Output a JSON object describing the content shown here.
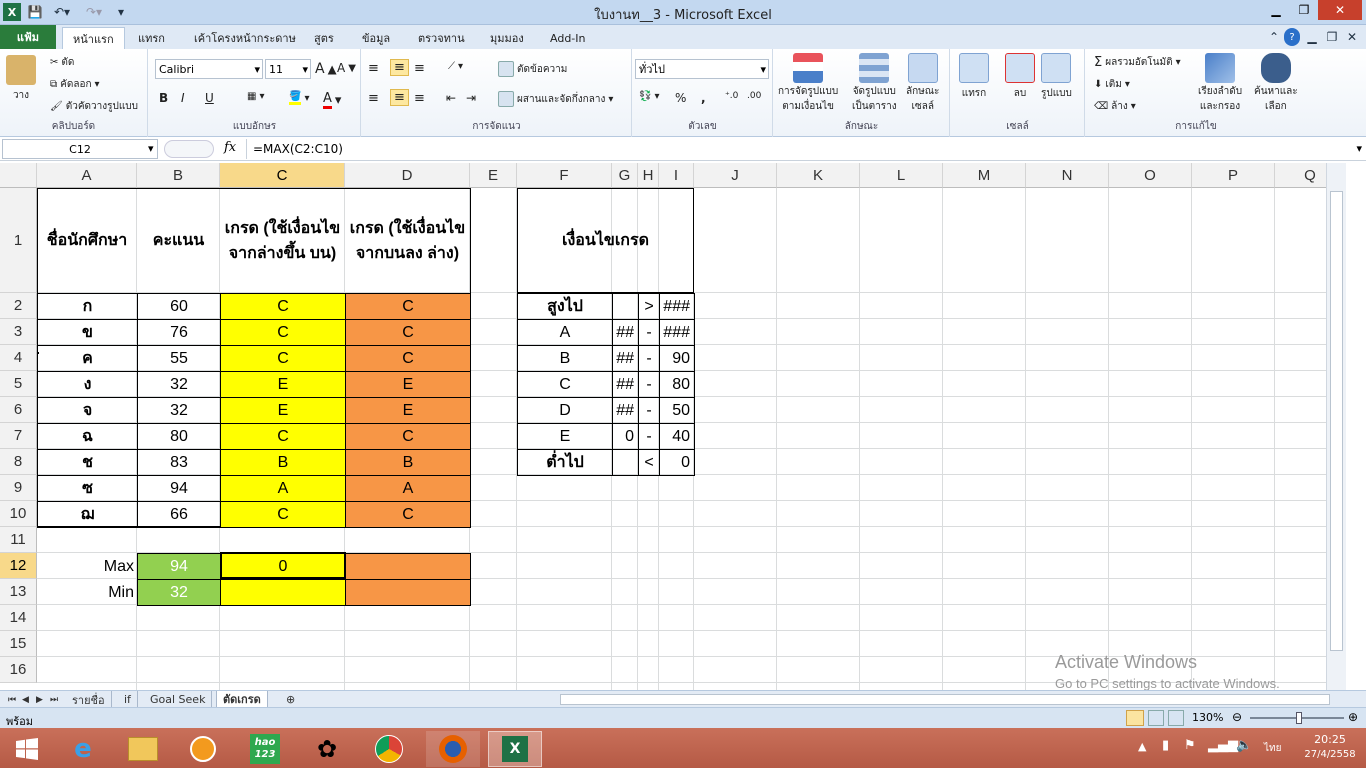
{
  "window": {
    "title": "ใบงานท__3  -  Microsoft Excel",
    "app_icon": "excel-icon"
  },
  "ribbon_tabs": [
    {
      "label": "แฟ้ม",
      "id": "file"
    },
    {
      "label": "หน้าแรก",
      "id": "home"
    },
    {
      "label": "แทรก",
      "id": "insert"
    },
    {
      "label": "เค้าโครงหน้ากระดาษ",
      "id": "page-layout"
    },
    {
      "label": "สูตร",
      "id": "formulas"
    },
    {
      "label": "ข้อมูล",
      "id": "data"
    },
    {
      "label": "ตรวจทาน",
      "id": "review"
    },
    {
      "label": "มุมมอง",
      "id": "view"
    },
    {
      "label": "Add-In",
      "id": "addin"
    }
  ],
  "ribbon": {
    "clipboard": {
      "paste": "วาง",
      "cut": "ตัด",
      "copy": "คัดลอก",
      "format_painter": "ตัวคัดวางรูปแบบ",
      "label": "คลิปบอร์ด"
    },
    "font": {
      "name": "Calibri",
      "size": "11",
      "bold": "B",
      "italic": "I",
      "underline": "U",
      "label": "แบบอักษร"
    },
    "alignment": {
      "wrap": "ตัดข้อความ",
      "merge": "ผสานและจัดกึ่งกลาง",
      "label": "การจัดแนว"
    },
    "number": {
      "format": "ทั่วไป",
      "percent": "%",
      "comma": ",",
      "label": "ตัวเลข"
    },
    "styles": {
      "cond_format": "การจัดรูปแบบ\nตามเงื่อนไข",
      "cond_1": "การจัดรูปแบบ",
      "cond_2": "ตามเงื่อนไข",
      "table_1": "จัดรูปแบบ",
      "table_2": "เป็นตาราง",
      "cell_1": "ลักษณะ",
      "cell_2": "เซลล์",
      "label": "ลักษณะ"
    },
    "cells": {
      "insert": "แทรก",
      "delete": "ลบ",
      "format": "รูปแบบ",
      "label": "เซลล์"
    },
    "editing": {
      "autosum": "ผลรวมอัตโนมัติ",
      "fill": "เติม",
      "clear": "ล้าง",
      "sort_1": "เรียงลำดับ",
      "sort_2": "และกรอง",
      "find_1": "ค้นหาและ",
      "find_2": "เลือก",
      "label": "การแก้ไข"
    }
  },
  "formula_bar": {
    "name_box": "C12",
    "fx": "fx",
    "formula": "=MAX(C2:C10)"
  },
  "columns": [
    "A",
    "B",
    "C",
    "D",
    "E",
    "F",
    "G",
    "H",
    "I",
    "J",
    "K",
    "L",
    "M",
    "N",
    "O",
    "P",
    "Q"
  ],
  "rows": [
    "1",
    "2",
    "3",
    "4",
    "5",
    "6",
    "7",
    "8",
    "9",
    "10",
    "11",
    "12",
    "13",
    "14",
    "15",
    "16"
  ],
  "headers": {
    "name": "ชื่อนักศึกษา",
    "score": "คะแนน",
    "grade_c": "เกรด (ใช้เงื่อนไข จากล่างขึ้น บน)",
    "grade_d": "เกรด (ใช้เงื่อนไข จากบนลง ล่าง)",
    "conditions": "เงื่อนไขเกรด"
  },
  "students": [
    {
      "name": "ก",
      "score": "60",
      "c": "C",
      "d": "C"
    },
    {
      "name": "ข",
      "score": "76",
      "c": "C",
      "d": "C"
    },
    {
      "name": "ค",
      "score": "55",
      "c": "C",
      "d": "C"
    },
    {
      "name": "ง",
      "score": "32",
      "c": "E",
      "d": "E"
    },
    {
      "name": "จ",
      "score": "32",
      "c": "E",
      "d": "E"
    },
    {
      "name": "ฉ",
      "score": "80",
      "c": "C",
      "d": "C"
    },
    {
      "name": "ช",
      "score": "83",
      "c": "B",
      "d": "B"
    },
    {
      "name": "ซ",
      "score": "94",
      "c": "A",
      "d": "A"
    },
    {
      "name": "ฌ",
      "score": "66",
      "c": "C",
      "d": "C"
    }
  ],
  "stats": [
    {
      "label": "Max",
      "b": "94",
      "c": "0",
      "d": ""
    },
    {
      "label": "Min",
      "b": "32",
      "c": "",
      "d": ""
    }
  ],
  "conditions": [
    {
      "f": "สูงไป",
      "g": "",
      "h": ">",
      "i": "###",
      "bold": true
    },
    {
      "f": "A",
      "g": "##",
      "h": "-",
      "i": "###",
      "bold": false
    },
    {
      "f": "B",
      "g": "##",
      "h": "-",
      "i": "90",
      "bold": false
    },
    {
      "f": "C",
      "g": "##",
      "h": "-",
      "i": "80",
      "bold": false
    },
    {
      "f": "D",
      "g": "##",
      "h": "-",
      "i": "50",
      "bold": false
    },
    {
      "f": "E",
      "g": "0",
      "h": "-",
      "i": "40",
      "bold": false
    },
    {
      "f": "ต่ำไป",
      "g": "",
      "h": "<",
      "i": "0",
      "bold": true
    }
  ],
  "sheet_tabs": [
    "รายชื่อ",
    "if",
    "Goal Seek",
    "ตัดเกรด"
  ],
  "active_sheet": "ตัดเกรด",
  "status": {
    "ready": "พร้อม",
    "zoom": "130%"
  },
  "watermark": {
    "line1": "Activate Windows",
    "line2": "Go to PC settings to activate Windows."
  },
  "taskbar": {
    "time": "20:25",
    "date": "27/4/2558",
    "lang": "ไทย",
    "hao": "hao\n123"
  },
  "colors": {
    "yellow": "#ffff00",
    "orange": "#f79646",
    "green": "#92d050",
    "file_tab": "#2a7c3b",
    "taskbar": "#b55a45"
  }
}
